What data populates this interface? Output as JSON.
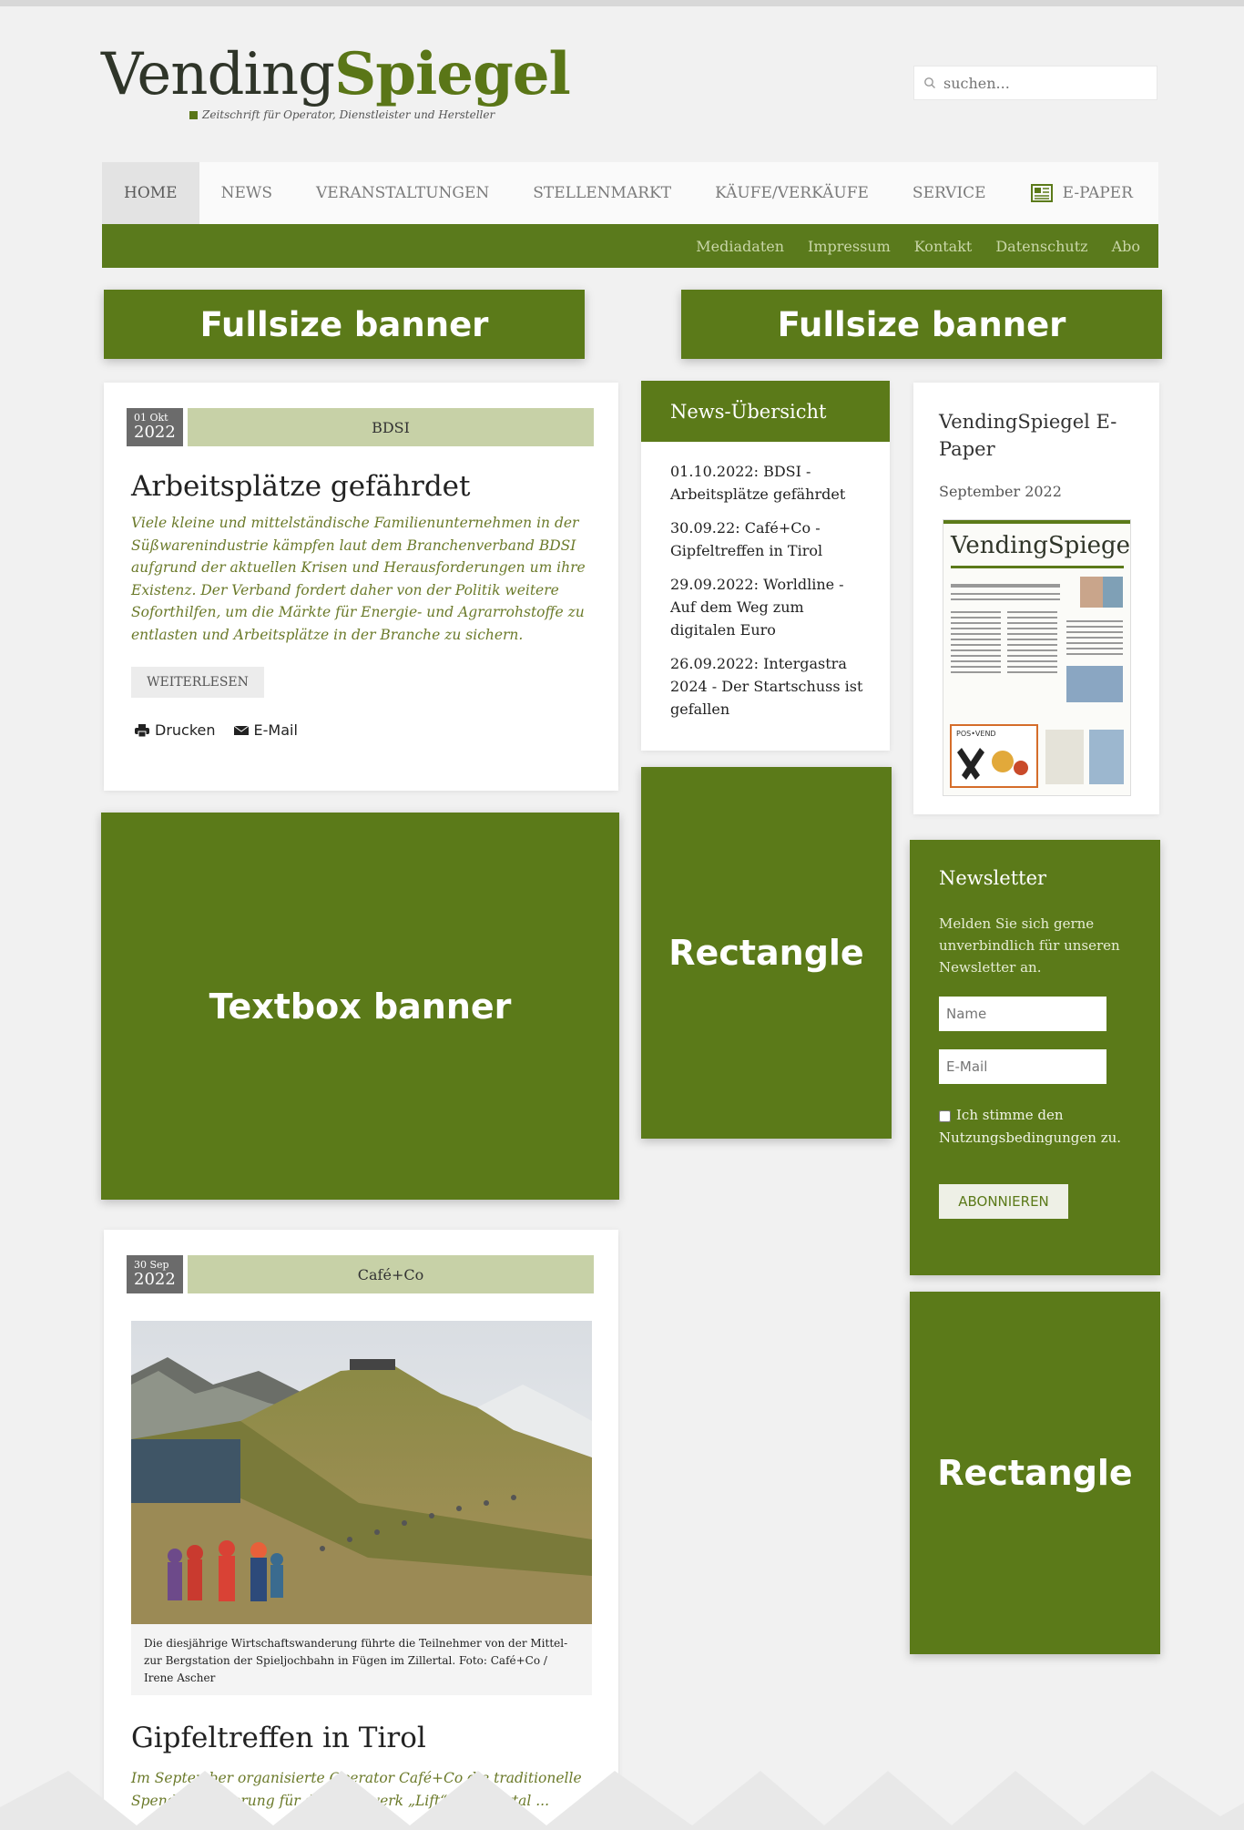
{
  "header": {
    "logo_part1": "Vending",
    "logo_part2": "Spiegel",
    "tagline": "Zeitschrift für Operator, Dienstleister und Hersteller",
    "search_placeholder": "suchen..."
  },
  "nav": {
    "items": [
      "HOME",
      "NEWS",
      "VERANSTALTUNGEN",
      "STELLENMARKT",
      "KÄUFE/VERKÄUFE",
      "SERVICE",
      "E-PAPER"
    ]
  },
  "subnav": {
    "items": [
      "Mediadaten",
      "Impressum",
      "Kontakt",
      "Datenschutz",
      "Abo"
    ]
  },
  "banners": {
    "fullsize_left": "Fullsize banner",
    "fullsize_right": "Fullsize banner",
    "textbox": "Textbox banner",
    "rectangle_1": "Rectangle",
    "rectangle_2": "Rectangle"
  },
  "article1": {
    "date_day": "01 Okt",
    "date_year": "2022",
    "category": "BDSI",
    "title": "Arbeitsplätze gefährdet",
    "lead": "Viele kleine und mittelständische Familienunternehmen in der Süßwarenindustrie kämpfen laut dem Branchenverband BDSI aufgrund der aktuellen Krisen und Herausforderungen um ihre Existenz. Der Verband fordert daher von der Politik weitere Soforthilfen, um die Märkte für Energie- und Agrarrohstoffe zu entlasten und Arbeitsplätze in der Branche zu sichern.",
    "readmore": "WEITERLESEN",
    "print": "Drucken",
    "email": "E-Mail"
  },
  "article2": {
    "date_day": "30 Sep",
    "date_year": "2022",
    "category": "Café+Co",
    "caption": "Die diesjährige Wirtschaftswanderung führte die Teilnehmer von der Mittel- zur Bergstation der Spieljochbahn in Fügen im Zillertal. Foto: Café+Co / Irene Ascher",
    "title": "Gipfeltreffen in Tirol",
    "lead": "Im September organisierte Operator Café+Co die traditionelle Spendenwanderung für das Netzwerk „Lift“ im Zillertal ..."
  },
  "news_overview": {
    "heading": "News-Übersicht",
    "items": [
      "01.10.2022: BDSI - Arbeitsplätze gefährdet",
      "30.09.22: Café+Co - Gipfeltreffen in Tirol",
      "29.09.2022: Worldline - Auf dem Weg zum digitalen Euro",
      "26.09.2022: Intergastra 2024 - Der Startschuss ist gefallen"
    ]
  },
  "epaper": {
    "title": "VendingSpiegel E-Paper",
    "date": "September 2022",
    "cover_logo": "VendingSpiegel"
  },
  "newsletter": {
    "heading": "Newsletter",
    "text": "Melden Sie sich gerne unverbindlich für unseren Newsletter an.",
    "name_placeholder": "Name",
    "email_placeholder": "E-Mail",
    "agree_text": "Ich stimme den Nutzungsbedingungen zu.",
    "subscribe": "ABONNIEREN"
  },
  "colors": {
    "brand_green": "#5b7a19",
    "category_bg": "#c7d1a7",
    "lead_text": "#6b7a2a"
  }
}
